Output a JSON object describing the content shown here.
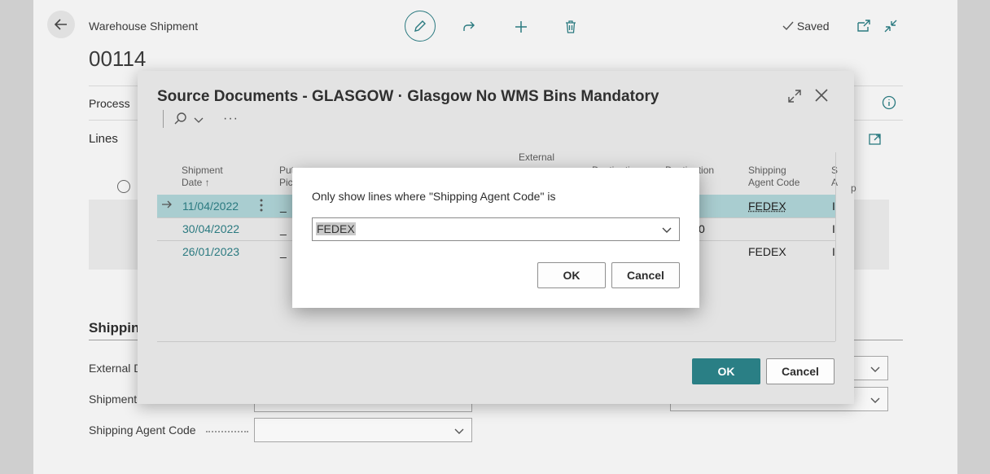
{
  "page": {
    "breadcrumb": "Warehouse Shipment",
    "document_no": "00114",
    "saved_status": "Saved",
    "process_tab": "Process",
    "lines_label": "Lines",
    "shipping_section": "Shippin",
    "external_doc_label": "External D",
    "shipment_label": "Shipment",
    "shipping_agent_label": "Shipping Agent Code"
  },
  "source_dialog": {
    "title": "Source Documents - GLASGOW · Glasgow No WMS Bins Mandatory",
    "more": "···",
    "columns": {
      "shipment_date_1": "Shipment",
      "shipment_date_2": "Date ↑",
      "put_pick_1": "Put",
      "put_pick_2": "Pic",
      "external_1": "External",
      "dest_partial": "Destinatio",
      "dest2_partial": "Destination",
      "shipping_agent_1": "Shipping",
      "shipping_agent_2": "Agent Code",
      "s_partial_1": "S",
      "s_partial_2": "A",
      "p_partial": "p"
    },
    "rows": [
      {
        "date": "11/04/2022",
        "put": "_",
        "agent": "FEDEX",
        "s": "I"
      },
      {
        "date": "30/04/2022",
        "put": "_",
        "agent": "",
        "s": "I"
      },
      {
        "date": "26/01/2023",
        "put": "_",
        "agent": "FEDEX",
        "s": "I"
      }
    ],
    "row2_partial": "0",
    "ok_label": "OK",
    "cancel_label": "Cancel"
  },
  "filter_dialog": {
    "prompt": "Only show lines where \"Shipping Agent Code\" is",
    "value": "FEDEX",
    "ok_label": "OK",
    "cancel_label": "Cancel"
  },
  "colors": {
    "accent": "#2a7f85",
    "selected_row": "#a9cdd0"
  }
}
